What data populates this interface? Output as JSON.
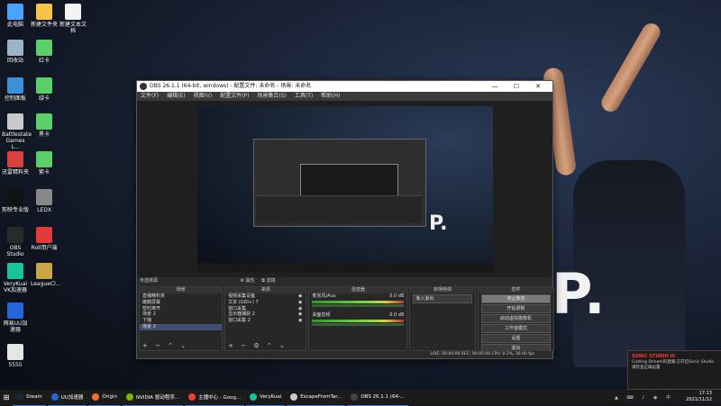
{
  "desktop": {
    "icons": [
      {
        "label": "此电脑",
        "color": "#4aa3ff"
      },
      {
        "label": "新建文件夹",
        "color": "#f3c34b"
      },
      {
        "label": "新建文本文档",
        "color": "#f4f4f4"
      },
      {
        "label": "回收站",
        "color": "#9db4c8"
      },
      {
        "label": "红卡",
        "color": "#5ccf6a"
      },
      {
        "label": "控制面板",
        "color": "#3d8fd8"
      },
      {
        "label": "绿卡",
        "color": "#5ccf6a"
      },
      {
        "label": "Battlestate Games L...",
        "color": "#c9c9c9"
      },
      {
        "label": "黑卡",
        "color": "#5ccf6a"
      },
      {
        "label": "迅雷精料夹",
        "color": "#d94141"
      },
      {
        "label": "紫卡",
        "color": "#5ccf6a"
      },
      {
        "label": "剪映专业版",
        "color": "#111111"
      },
      {
        "label": "LEDX",
        "color": "#888888"
      },
      {
        "label": "OBS Studio",
        "color": "#2a2a2a"
      },
      {
        "label": "Roll用户端",
        "color": "#e23b3b"
      },
      {
        "label": "VeryKuai VK加速器",
        "color": "#19c39b"
      },
      {
        "label": "LeagueCl...",
        "color": "#c8a64a"
      },
      {
        "label": "网易UU加速器",
        "color": "#2566d8"
      },
      {
        "label": "5555",
        "color": "#e5e5e5"
      }
    ]
  },
  "obs": {
    "title": "OBS 26.1.1 (64-bit, windows) - 配置文件: 未命名 - 场景: 未命名",
    "window_buttons": [
      "—",
      "☐",
      "✕"
    ],
    "menu": [
      "文件(F)",
      "编辑(E)",
      "视图(V)",
      "配置文件(P)",
      "场景集合(S)",
      "工具(T)",
      "帮助(H)"
    ],
    "preview_text": "P.",
    "no_source": "未选择源",
    "props_btn": "⚙ 属性",
    "filters_btn": "⧉ 滤镜",
    "docks": {
      "scenes": {
        "title": "场景",
        "items": [
          "直播精料夹",
          "嫩截屏幕",
          "暂时离开",
          "场景 2",
          "下播",
          "场景 3"
        ],
        "selected": 5
      },
      "sources": {
        "title": "来源",
        "items": [
          "视频采集设备",
          "文本 (GDI+) 7",
          "窗口采集",
          "显示器捕获 2",
          "窗口采集 2"
        ]
      },
      "mixer": {
        "title": "混音器",
        "ch1": "麦克风/Aux",
        "ch1_db": "0.0 dB",
        "ch2": "桌面音频",
        "ch2_db": "0.0 dB"
      },
      "transitions": {
        "title": "转场特效",
        "mode": "渐入渐出"
      },
      "controls": {
        "title": "控件",
        "buttons": [
          "停止推流",
          "开始录制",
          "启动虚拟摄像机",
          "工作室模式",
          "设置",
          "退出"
        ]
      }
    },
    "status": "LIVE: 00:00:00   REC: 00:00:00   CPU: 0.2%, 30.00 fps"
  },
  "popup": {
    "title": "SONIC STUDIO III",
    "body": "Casting Stream的直播,已开启Sonic Studio 请检查正确设置"
  },
  "taskbar": {
    "items": [
      {
        "label": "Steam",
        "color": "#1b2838"
      },
      {
        "label": "UU加速器",
        "color": "#2566d8"
      },
      {
        "label": "Origin",
        "color": "#f56c2d"
      },
      {
        "label": "NVIDIA 驱动程序...",
        "color": "#76b900"
      },
      {
        "label": "主播中心 - Goog...",
        "color": "#ea4335"
      },
      {
        "label": "VeryKuai",
        "color": "#19c39b"
      },
      {
        "label": "EscapeFromTar...",
        "color": "#cccccc"
      },
      {
        "label": "OBS 26.1.1 (64-...",
        "color": "#444444"
      }
    ],
    "time": "17:13",
    "date": "2021/11/12"
  }
}
